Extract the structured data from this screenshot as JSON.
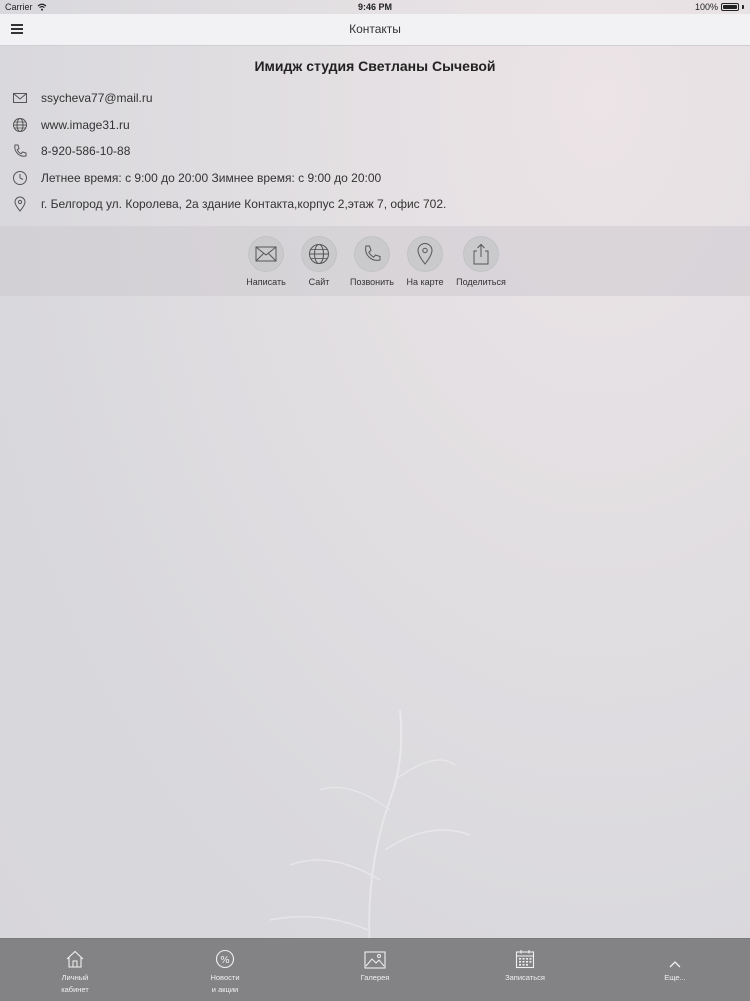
{
  "status_bar": {
    "carrier": "Carrier",
    "time": "9:46 PM",
    "battery": "100%"
  },
  "nav": {
    "title": "Контакты"
  },
  "company": {
    "name": "Имидж студия Светланы Сычевой"
  },
  "contacts": {
    "email": "ssycheva77@mail.ru",
    "website": "www.image31.ru",
    "phone": "8-920-586-10-88",
    "hours": "Летнее время: с 9:00 до 20:00 Зимнее время: с 9:00 до 20:00",
    "address": "г. Белгород ул. Королева, 2а здание Контакта,корпус 2,этаж 7, офис 702."
  },
  "actions": {
    "write": "Написать",
    "site": "Сайт",
    "call": "Позвонить",
    "map": "На карте",
    "share": "Поделиться"
  },
  "tabs": {
    "cabinet_line1": "Личный",
    "cabinet_line2": "кабинет",
    "news_line1": "Новости",
    "news_line2": "и акции",
    "gallery": "Галерея",
    "booking": "Записаться",
    "more": "Еще..."
  },
  "colors": {
    "tab_bar": "#838386",
    "nav_bar": "#f2f2f4"
  }
}
